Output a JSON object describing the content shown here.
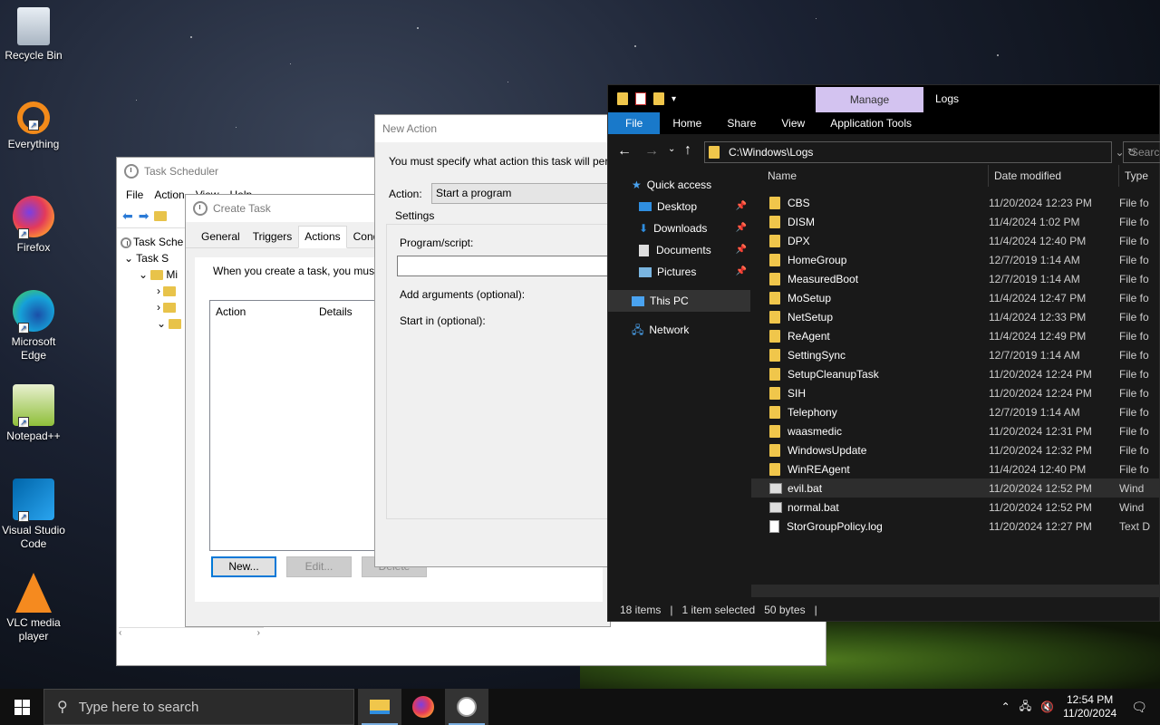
{
  "desktop": {
    "icons": [
      {
        "label": "Recycle Bin"
      },
      {
        "label": "Everything"
      },
      {
        "label": "Firefox"
      },
      {
        "label": "Microsoft Edge"
      },
      {
        "label": "Notepad++"
      },
      {
        "label": "Visual Studio Code"
      },
      {
        "label": "VLC media player"
      }
    ]
  },
  "task_scheduler": {
    "title": "Task Scheduler",
    "menu": [
      "File",
      "Action",
      "View",
      "Help"
    ],
    "tree": [
      "Task Sche",
      "Task S",
      "Mi"
    ]
  },
  "create_task": {
    "title": "Create Task",
    "tabs": [
      "General",
      "Triggers",
      "Actions",
      "Conditi"
    ],
    "description": "When you create a task, you must",
    "columns": {
      "action": "Action",
      "details": "Details"
    },
    "buttons": {
      "new": "New...",
      "edit": "Edit...",
      "delete": "Delete"
    }
  },
  "new_action": {
    "title": "New Action",
    "instruction": "You must specify what action this task will per",
    "action_label": "Action:",
    "action_value": "Start a program",
    "settings_label": "Settings",
    "program_label": "Program/script:",
    "program_value": "",
    "args_label": "Add arguments (optional):",
    "startin_label": "Start in (optional):"
  },
  "explorer": {
    "title": "Logs",
    "manage_tab": "Manage",
    "ribbon": {
      "file": "File",
      "home": "Home",
      "share": "Share",
      "view": "View",
      "app_tools": "Application Tools"
    },
    "address": "C:\\Windows\\Logs",
    "search_placeholder": "Search",
    "nav": {
      "quick_access": "Quick access",
      "desktop": "Desktop",
      "downloads": "Downloads",
      "documents": "Documents",
      "pictures": "Pictures",
      "this_pc": "This PC",
      "network": "Network"
    },
    "columns": {
      "name": "Name",
      "date": "Date modified",
      "type": "Type"
    },
    "files": [
      {
        "name": "CBS",
        "date": "11/20/2024 12:23 PM",
        "type": "File fo",
        "kind": "folder"
      },
      {
        "name": "DISM",
        "date": "11/4/2024 1:02 PM",
        "type": "File fo",
        "kind": "folder"
      },
      {
        "name": "DPX",
        "date": "11/4/2024 12:40 PM",
        "type": "File fo",
        "kind": "folder"
      },
      {
        "name": "HomeGroup",
        "date": "12/7/2019 1:14 AM",
        "type": "File fo",
        "kind": "folder"
      },
      {
        "name": "MeasuredBoot",
        "date": "12/7/2019 1:14 AM",
        "type": "File fo",
        "kind": "folder"
      },
      {
        "name": "MoSetup",
        "date": "11/4/2024 12:47 PM",
        "type": "File fo",
        "kind": "folder"
      },
      {
        "name": "NetSetup",
        "date": "11/4/2024 12:33 PM",
        "type": "File fo",
        "kind": "folder"
      },
      {
        "name": "ReAgent",
        "date": "11/4/2024 12:49 PM",
        "type": "File fo",
        "kind": "folder"
      },
      {
        "name": "SettingSync",
        "date": "12/7/2019 1:14 AM",
        "type": "File fo",
        "kind": "folder"
      },
      {
        "name": "SetupCleanupTask",
        "date": "11/20/2024 12:24 PM",
        "type": "File fo",
        "kind": "folder"
      },
      {
        "name": "SIH",
        "date": "11/20/2024 12:24 PM",
        "type": "File fo",
        "kind": "folder"
      },
      {
        "name": "Telephony",
        "date": "12/7/2019 1:14 AM",
        "type": "File fo",
        "kind": "folder"
      },
      {
        "name": "waasmedic",
        "date": "11/20/2024 12:31 PM",
        "type": "File fo",
        "kind": "folder"
      },
      {
        "name": "WindowsUpdate",
        "date": "11/20/2024 12:32 PM",
        "type": "File fo",
        "kind": "folder"
      },
      {
        "name": "WinREAgent",
        "date": "11/4/2024 12:40 PM",
        "type": "File fo",
        "kind": "folder"
      },
      {
        "name": "evil.bat",
        "date": "11/20/2024 12:52 PM",
        "type": "Wind",
        "kind": "bat",
        "selected": true
      },
      {
        "name": "normal.bat",
        "date": "11/20/2024 12:52 PM",
        "type": "Wind",
        "kind": "bat"
      },
      {
        "name": "StorGroupPolicy.log",
        "date": "11/20/2024 12:27 PM",
        "type": "Text D",
        "kind": "log"
      }
    ],
    "status": {
      "items": "18 items",
      "selected": "1 item selected",
      "size": "50 bytes"
    }
  },
  "taskbar": {
    "search_placeholder": "Type here to search",
    "time": "12:54 PM",
    "date": "11/20/2024"
  },
  "colors": {
    "accent": "#1979ca",
    "manage_tab": "#d3c3f0",
    "folder": "#f0c64b"
  }
}
